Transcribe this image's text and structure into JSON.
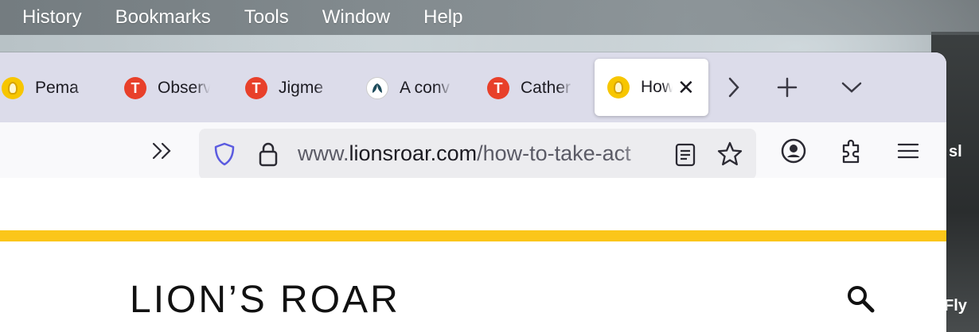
{
  "menubar": {
    "items": [
      "History",
      "Bookmarks",
      "Tools",
      "Window",
      "Help"
    ]
  },
  "tabs": [
    {
      "title": "Pema",
      "favicon": "lion-icon"
    },
    {
      "title": "Observ",
      "favicon": "T"
    },
    {
      "title": "Jigme",
      "favicon": "T"
    },
    {
      "title": "A conv",
      "favicon": "leaf-icon"
    },
    {
      "title": "Cather",
      "favicon": "T"
    },
    {
      "title": "How",
      "favicon": "lion-icon",
      "active": true
    }
  ],
  "urlbar": {
    "prefix": "www.",
    "domain": "lionsroar.com",
    "path": "/how-to-take-act"
  },
  "page": {
    "logo_text": "LION’S ROAR"
  },
  "desktop_side_text": {
    "line1": "sl",
    "line2": "Fly"
  },
  "colors": {
    "accent_bar": "#fbc61a",
    "tab_strip": "#dcdcea",
    "favicon_red": "#e8402a",
    "favicon_yellow": "#f7c600"
  }
}
